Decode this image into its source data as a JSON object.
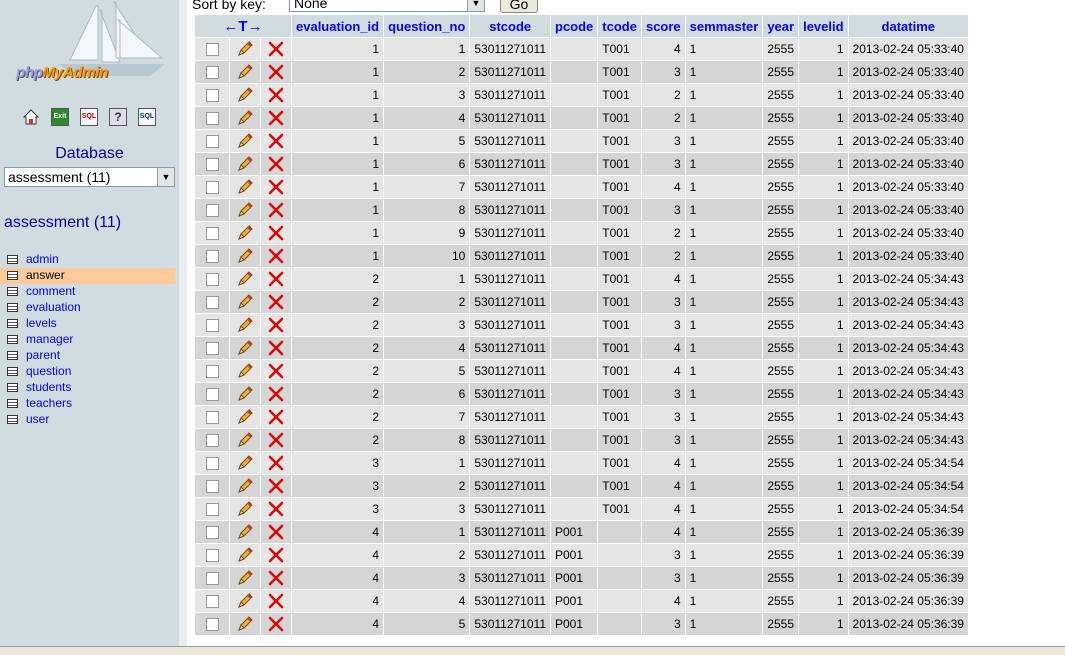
{
  "sidebar": {
    "logo_prefix": "php",
    "logo_suffix": "MyAdmin",
    "db_label": "Database",
    "db_select_value": "assessment (11)",
    "db_title": "assessment (11)",
    "quick_icons": [
      "home-icon",
      "exit-icon",
      "sql-icon",
      "help-icon",
      "sql-query-icon"
    ],
    "tables": [
      "admin",
      "answer",
      "comment",
      "evaluation",
      "levels",
      "manager",
      "parent",
      "question",
      "students",
      "teachers",
      "user"
    ],
    "active_table": "answer"
  },
  "topbar": {
    "sort_label": "Sort by key:",
    "sort_value": "None",
    "go_label": "Go"
  },
  "grid": {
    "arrows_label": "←T→",
    "columns": [
      "evaluation_id",
      "question_no",
      "stcode",
      "pcode",
      "tcode",
      "score",
      "semmaster",
      "year",
      "levelid",
      "datatime"
    ],
    "rows": [
      [
        "1",
        "1",
        "53011271011",
        "",
        "T001",
        "4",
        "1",
        "2555",
        "1",
        "2013-02-24 05:33:40"
      ],
      [
        "1",
        "2",
        "53011271011",
        "",
        "T001",
        "3",
        "1",
        "2555",
        "1",
        "2013-02-24 05:33:40"
      ],
      [
        "1",
        "3",
        "53011271011",
        "",
        "T001",
        "2",
        "1",
        "2555",
        "1",
        "2013-02-24 05:33:40"
      ],
      [
        "1",
        "4",
        "53011271011",
        "",
        "T001",
        "2",
        "1",
        "2555",
        "1",
        "2013-02-24 05:33:40"
      ],
      [
        "1",
        "5",
        "53011271011",
        "",
        "T001",
        "3",
        "1",
        "2555",
        "1",
        "2013-02-24 05:33:40"
      ],
      [
        "1",
        "6",
        "53011271011",
        "",
        "T001",
        "3",
        "1",
        "2555",
        "1",
        "2013-02-24 05:33:40"
      ],
      [
        "1",
        "7",
        "53011271011",
        "",
        "T001",
        "4",
        "1",
        "2555",
        "1",
        "2013-02-24 05:33:40"
      ],
      [
        "1",
        "8",
        "53011271011",
        "",
        "T001",
        "3",
        "1",
        "2555",
        "1",
        "2013-02-24 05:33:40"
      ],
      [
        "1",
        "9",
        "53011271011",
        "",
        "T001",
        "2",
        "1",
        "2555",
        "1",
        "2013-02-24 05:33:40"
      ],
      [
        "1",
        "10",
        "53011271011",
        "",
        "T001",
        "2",
        "1",
        "2555",
        "1",
        "2013-02-24 05:33:40"
      ],
      [
        "2",
        "1",
        "53011271011",
        "",
        "T001",
        "4",
        "1",
        "2555",
        "1",
        "2013-02-24 05:34:43"
      ],
      [
        "2",
        "2",
        "53011271011",
        "",
        "T001",
        "3",
        "1",
        "2555",
        "1",
        "2013-02-24 05:34:43"
      ],
      [
        "2",
        "3",
        "53011271011",
        "",
        "T001",
        "3",
        "1",
        "2555",
        "1",
        "2013-02-24 05:34:43"
      ],
      [
        "2",
        "4",
        "53011271011",
        "",
        "T001",
        "4",
        "1",
        "2555",
        "1",
        "2013-02-24 05:34:43"
      ],
      [
        "2",
        "5",
        "53011271011",
        "",
        "T001",
        "4",
        "1",
        "2555",
        "1",
        "2013-02-24 05:34:43"
      ],
      [
        "2",
        "6",
        "53011271011",
        "",
        "T001",
        "3",
        "1",
        "2555",
        "1",
        "2013-02-24 05:34:43"
      ],
      [
        "2",
        "7",
        "53011271011",
        "",
        "T001",
        "3",
        "1",
        "2555",
        "1",
        "2013-02-24 05:34:43"
      ],
      [
        "2",
        "8",
        "53011271011",
        "",
        "T001",
        "3",
        "1",
        "2555",
        "1",
        "2013-02-24 05:34:43"
      ],
      [
        "3",
        "1",
        "53011271011",
        "",
        "T001",
        "4",
        "1",
        "2555",
        "1",
        "2013-02-24 05:34:54"
      ],
      [
        "3",
        "2",
        "53011271011",
        "",
        "T001",
        "4",
        "1",
        "2555",
        "1",
        "2013-02-24 05:34:54"
      ],
      [
        "3",
        "3",
        "53011271011",
        "",
        "T001",
        "4",
        "1",
        "2555",
        "1",
        "2013-02-24 05:34:54"
      ],
      [
        "4",
        "1",
        "53011271011",
        "P001",
        "",
        "4",
        "1",
        "2555",
        "1",
        "2013-02-24 05:36:39"
      ],
      [
        "4",
        "2",
        "53011271011",
        "P001",
        "",
        "3",
        "1",
        "2555",
        "1",
        "2013-02-24 05:36:39"
      ],
      [
        "4",
        "3",
        "53011271011",
        "P001",
        "",
        "3",
        "1",
        "2555",
        "1",
        "2013-02-24 05:36:39"
      ],
      [
        "4",
        "4",
        "53011271011",
        "P001",
        "",
        "4",
        "1",
        "2555",
        "1",
        "2013-02-24 05:36:39"
      ],
      [
        "4",
        "5",
        "53011271011",
        "P001",
        "",
        "3",
        "1",
        "2555",
        "1",
        "2013-02-24 05:36:39"
      ]
    ]
  }
}
